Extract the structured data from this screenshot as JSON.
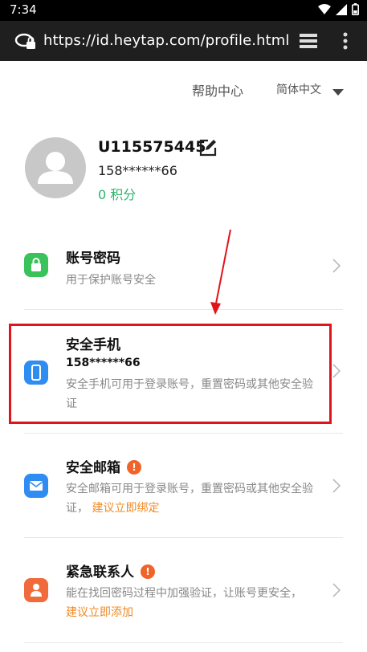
{
  "status_bar": {
    "time": "7:34"
  },
  "browser": {
    "url": "https://id.heytap.com/profile.html"
  },
  "header": {
    "help": "帮助中心",
    "language": "简体中文"
  },
  "profile": {
    "username": "U115575445",
    "phone": "158******66",
    "points": "0 积分"
  },
  "items": [
    {
      "title": "账号密码",
      "desc": "用于保护账号安全",
      "icon": "lock-icon",
      "color": "#39c35a"
    },
    {
      "title": "安全手机",
      "value": "158******66",
      "desc": "安全手机可用于登录账号，重置密码或其他安全验证",
      "icon": "phone-icon",
      "color": "#2f8cf0"
    },
    {
      "title": "安全邮箱",
      "desc": "安全邮箱可用于登录账号，重置密码或其他安全验证，",
      "link": "建议立即绑定",
      "icon": "mail-icon",
      "color": "#2f8cf0"
    },
    {
      "title": "紧急联系人",
      "desc": "能在找回密码过程中加强验证，让账号更安全，",
      "link": "建议立即添加",
      "icon": "contact-icon",
      "color": "#f06a3c"
    }
  ],
  "colors": {
    "accent_green": "#2ab36c",
    "highlight": "#e0151b",
    "link": "#f08a24"
  }
}
